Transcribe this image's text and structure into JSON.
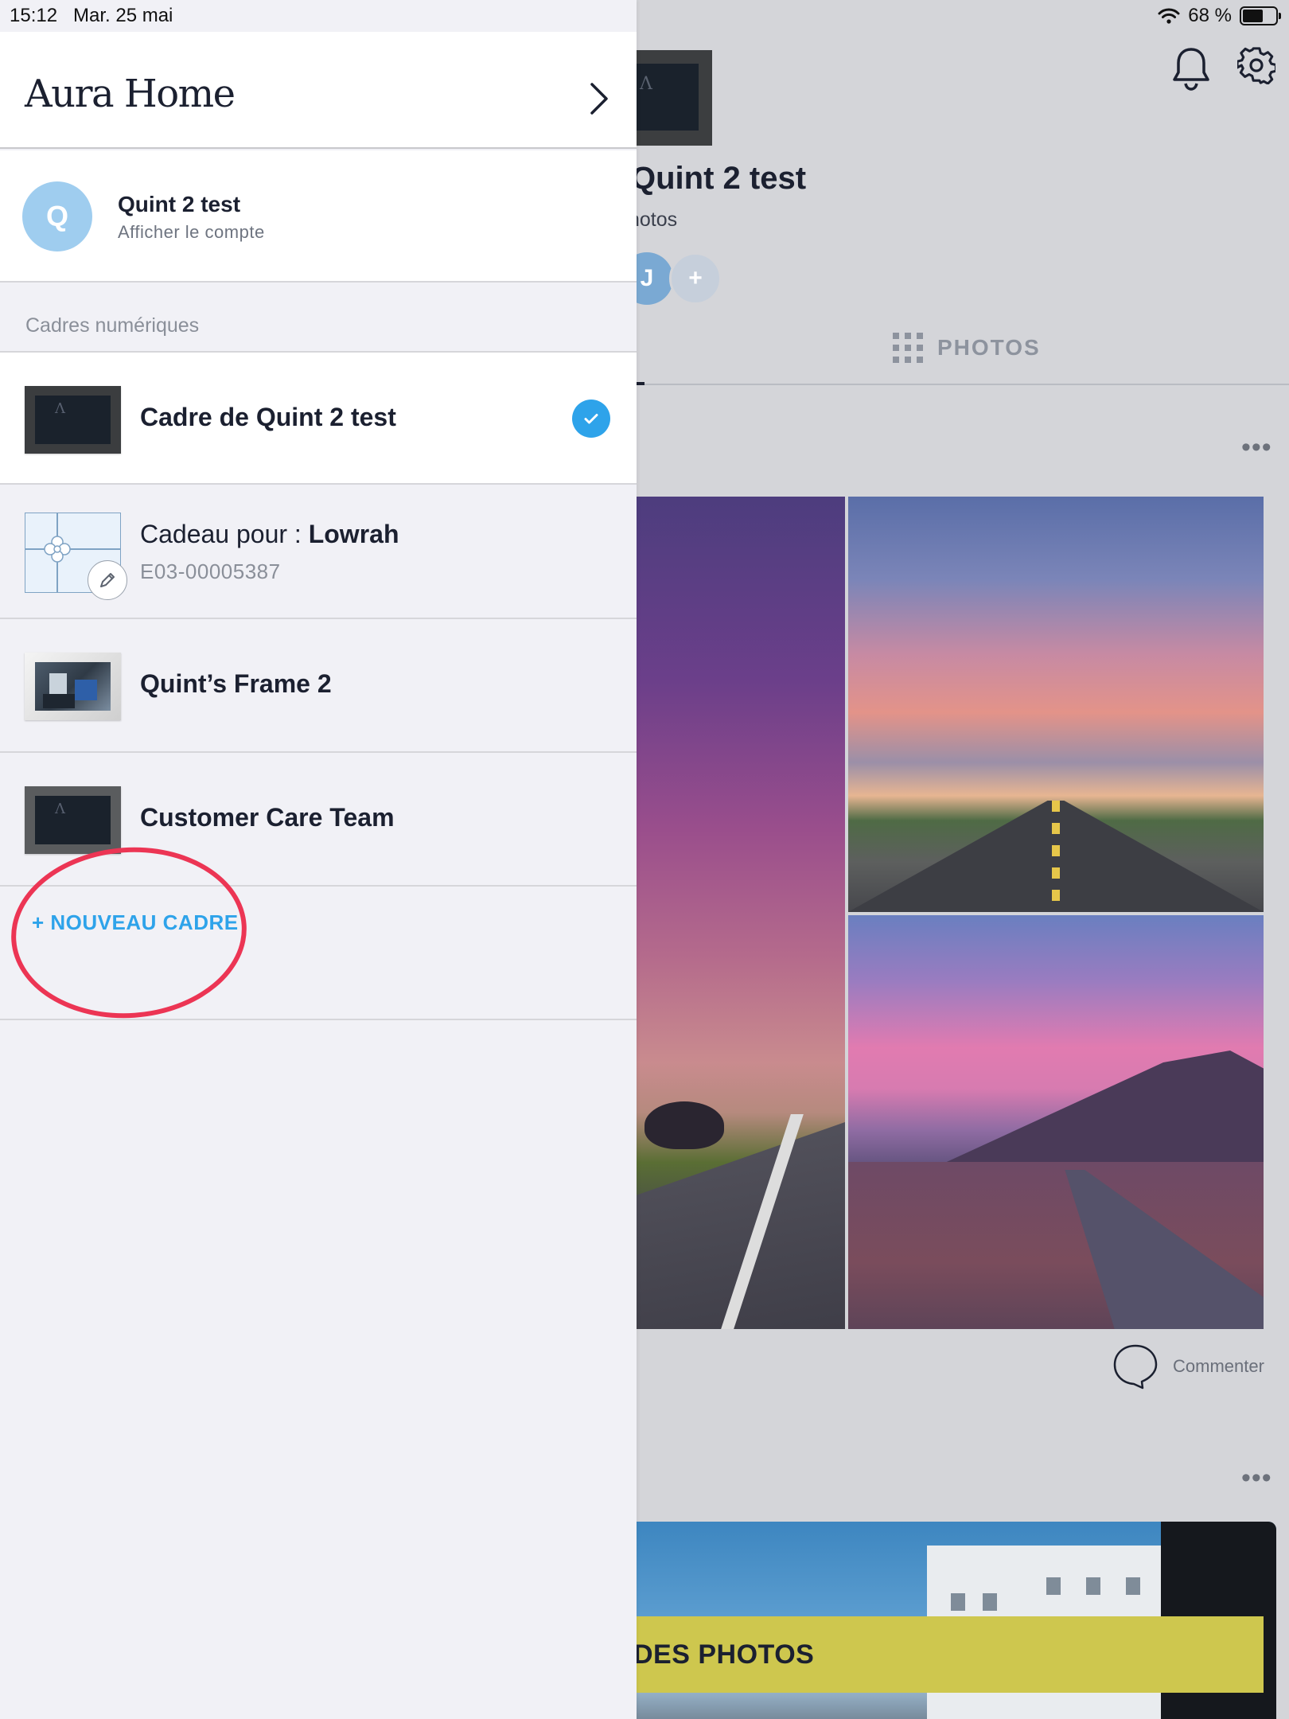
{
  "status_bar": {
    "time": "15:12",
    "date": "Mar. 25 mai",
    "battery": "68 %"
  },
  "main": {
    "title": "Quint 2 test",
    "subtitle": "hotos",
    "avatar_initial": "J",
    "add_glyph": "+",
    "tab_label": "PHOTOS",
    "more_glyph": "•••",
    "comment_label": "Commenter",
    "banner_label": "DES PHOTOS",
    "frame_logo": "Λ"
  },
  "drawer": {
    "brand": "Aura Home",
    "account": {
      "initial": "Q",
      "name": "Quint 2 test",
      "subtitle": "Afficher le compte"
    },
    "section_title": "Cadres numériques",
    "frames": [
      {
        "label": "Cadre de Quint 2 test",
        "selected": true
      },
      {
        "label_prefix": "Cadeau pour : ",
        "label_name": "Lowrah",
        "code": "E03-00005387"
      },
      {
        "label": "Quint’s Frame 2"
      },
      {
        "label": "Customer Care Team"
      }
    ],
    "new_frame_label": "+ NOUVEAU CADRE"
  },
  "colors": {
    "accent": "#2ea3ea",
    "highlight_ring": "#ec3554",
    "banner": "#cec74e"
  }
}
